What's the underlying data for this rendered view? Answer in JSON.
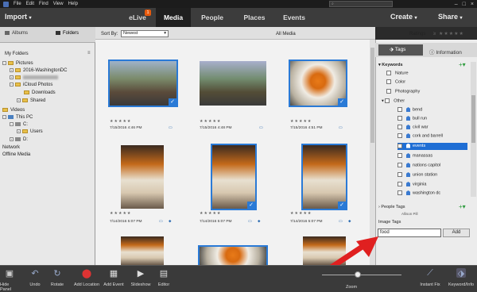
{
  "menubar": {
    "items": [
      "File",
      "Edit",
      "Find",
      "View",
      "Help"
    ],
    "search_placeholder": "Search"
  },
  "topbar": {
    "import_label": "Import",
    "tabs": [
      "eLive",
      "Media",
      "People",
      "Places",
      "Events"
    ],
    "active_tab": "Media",
    "elive_badge": "1",
    "create_label": "Create",
    "share_label": "Share"
  },
  "left_panel": {
    "tabs": [
      "Albums",
      "Folders"
    ],
    "active_tab": "Folders",
    "section_title": "My Folders",
    "tree": {
      "pictures": "Pictures",
      "washington": "2016-WashingtonDC",
      "icloud": "iCloud Photos",
      "downloads": "Downloads",
      "shared": "Shared",
      "videos": "Videos",
      "thispc": "This PC",
      "c_drive": "C:",
      "users": "Users",
      "d_drive": "D:",
      "network": "Network",
      "offline": "Offline Media"
    }
  },
  "sortbar": {
    "sort_label": "Sort By:",
    "sort_value": "Newest",
    "view_title": "All Media",
    "ratings_label": "Ratings"
  },
  "grid": {
    "items": [
      {
        "date": "7/15/2016 4:46 PM"
      },
      {
        "date": "7/15/2016 4:48 PM"
      },
      {
        "date": "7/15/2016 4:51 PM"
      },
      {
        "date": "7/14/2016 5:07 PM"
      },
      {
        "date": "7/14/2016 5:07 PM"
      },
      {
        "date": "7/14/2016 5:07 PM"
      }
    ]
  },
  "right_panel": {
    "tabs": [
      "Tags",
      "Information"
    ],
    "active_tab": "Tags",
    "keywords_title": "Keywords",
    "keywords": [
      "Nature",
      "Color",
      "Photography",
      "Other"
    ],
    "other_children": [
      "bend",
      "bull run",
      "civil war",
      "cork and barrell",
      "events",
      "manassas",
      "nations capitol",
      "union station",
      "virginia",
      "washington dc"
    ],
    "selected_keyword": "events",
    "people_tags_title": "People Tags",
    "people_partial": "Allison Pill",
    "image_tags_title": "Image Tags",
    "tag_input_value": "food",
    "add_label": "Add"
  },
  "bottombar": {
    "buttons": [
      "Hide Panel",
      "Undo",
      "Rotate",
      "Add Location",
      "Add Event",
      "Slideshow",
      "Editor",
      "Instant Fix",
      "Keyword/Info"
    ],
    "zoom_label": "Zoom",
    "zoom_level": 0.45
  },
  "colors": {
    "accent": "#2a7ad6",
    "badge": "#e85a0c",
    "arrow": "#e02020"
  }
}
